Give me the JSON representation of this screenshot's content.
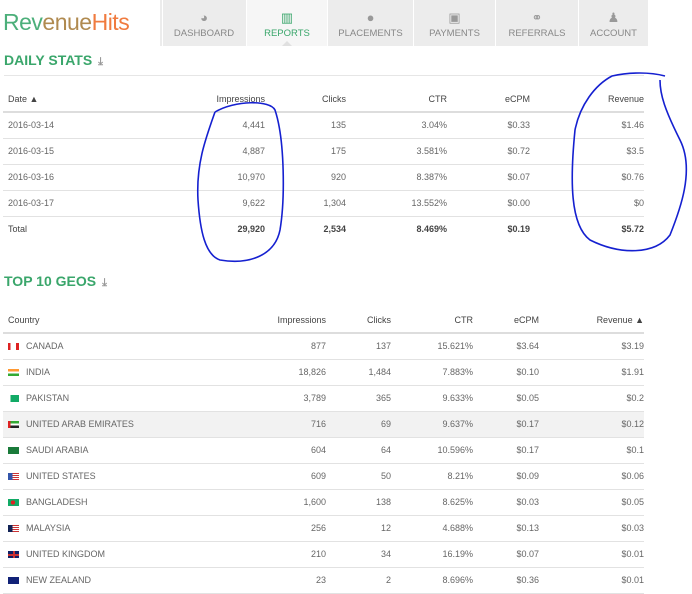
{
  "logo": {
    "part1": "Rev",
    "part2": "enue",
    "part3": "Hits"
  },
  "nav": [
    {
      "label": "DASHBOARD",
      "icon": "dashboard-icon",
      "glyph": "◕"
    },
    {
      "label": "REPORTS",
      "icon": "bar-chart-icon",
      "glyph": "▥",
      "active": true
    },
    {
      "label": "PLACEMENTS",
      "icon": "globe-icon",
      "glyph": "●"
    },
    {
      "label": "PAYMENTS",
      "icon": "money-icon",
      "glyph": "▣"
    },
    {
      "label": "REFERRALS",
      "icon": "link-icon",
      "glyph": "⚭"
    },
    {
      "label": "ACCOUNT",
      "icon": "user-icon",
      "glyph": "♟"
    }
  ],
  "daily": {
    "title": "DAILY STATS",
    "download": "⤓",
    "headers": [
      "Date ▲",
      "Impressions",
      "Clicks",
      "CTR",
      "eCPM",
      "Revenue"
    ],
    "rows": [
      [
        "2016-03-14",
        "4,441",
        "135",
        "3.04%",
        "$0.33",
        "$1.46"
      ],
      [
        "2016-03-15",
        "4,887",
        "175",
        "3.581%",
        "$0.72",
        "$3.5"
      ],
      [
        "2016-03-16",
        "10,970",
        "920",
        "8.387%",
        "$0.07",
        "$0.76"
      ],
      [
        "2016-03-17",
        "9,622",
        "1,304",
        "13.552%",
        "$0.00",
        "$0"
      ]
    ],
    "total": [
      "Total",
      "29,920",
      "2,534",
      "8.469%",
      "$0.19",
      "$5.72"
    ]
  },
  "geos": {
    "title": "TOP 10 GEOS",
    "download": "⤓",
    "headers": [
      "Country",
      "Impressions",
      "Clicks",
      "CTR",
      "eCPM",
      "Revenue ▲"
    ],
    "rows": [
      [
        "CANADA",
        "877",
        "137",
        "15.621%",
        "$3.64",
        "$3.19"
      ],
      [
        "INDIA",
        "18,826",
        "1,484",
        "7.883%",
        "$0.10",
        "$1.91"
      ],
      [
        "PAKISTAN",
        "3,789",
        "365",
        "9.633%",
        "$0.05",
        "$0.2"
      ],
      [
        "UNITED ARAB EMIRATES",
        "716",
        "69",
        "9.637%",
        "$0.17",
        "$0.12"
      ],
      [
        "SAUDI ARABIA",
        "604",
        "64",
        "10.596%",
        "$0.17",
        "$0.1"
      ],
      [
        "UNITED STATES",
        "609",
        "50",
        "8.21%",
        "$0.09",
        "$0.06"
      ],
      [
        "BANGLADESH",
        "1,600",
        "138",
        "8.625%",
        "$0.03",
        "$0.05"
      ],
      [
        "MALAYSIA",
        "256",
        "12",
        "4.688%",
        "$0.13",
        "$0.03"
      ],
      [
        "UNITED KINGDOM",
        "210",
        "34",
        "16.19%",
        "$0.07",
        "$0.01"
      ],
      [
        "NEW ZEALAND",
        "23",
        "2",
        "8.696%",
        "$0.36",
        "$0.01"
      ]
    ],
    "flag_colors": [
      "linear-gradient(90deg,#d22 25%,#fff 25%,#fff 75%,#d22 75%)",
      "linear-gradient(#f93 33%,#fff 33%,#fff 66%,#3a3 66%)",
      "linear-gradient(90deg,#fff 25%,#1a6 25%)",
      "linear-gradient(90deg,#d22 25%,transparent 25%),linear-gradient(#3a3 33%,#fff 33%,#fff 66%,#222 66%)",
      "#1a7a3a",
      "linear-gradient(90deg,#35a 40%,transparent 40%),repeating-linear-gradient(#c33 0 1px,#fff 1px 2px)",
      "radial-gradient(circle at 45% 50%,#d22 30%,#1a6 32%)",
      "linear-gradient(90deg,#125 40%,transparent 40%),repeating-linear-gradient(#c33 0 1px,#fff 1px 2px)",
      "linear-gradient(#c33,#c33) center/100% 2px no-repeat,linear-gradient(#c33,#c33) center/2px 100% no-repeat,#126",
      "linear-gradient(#127,#127)"
    ]
  }
}
